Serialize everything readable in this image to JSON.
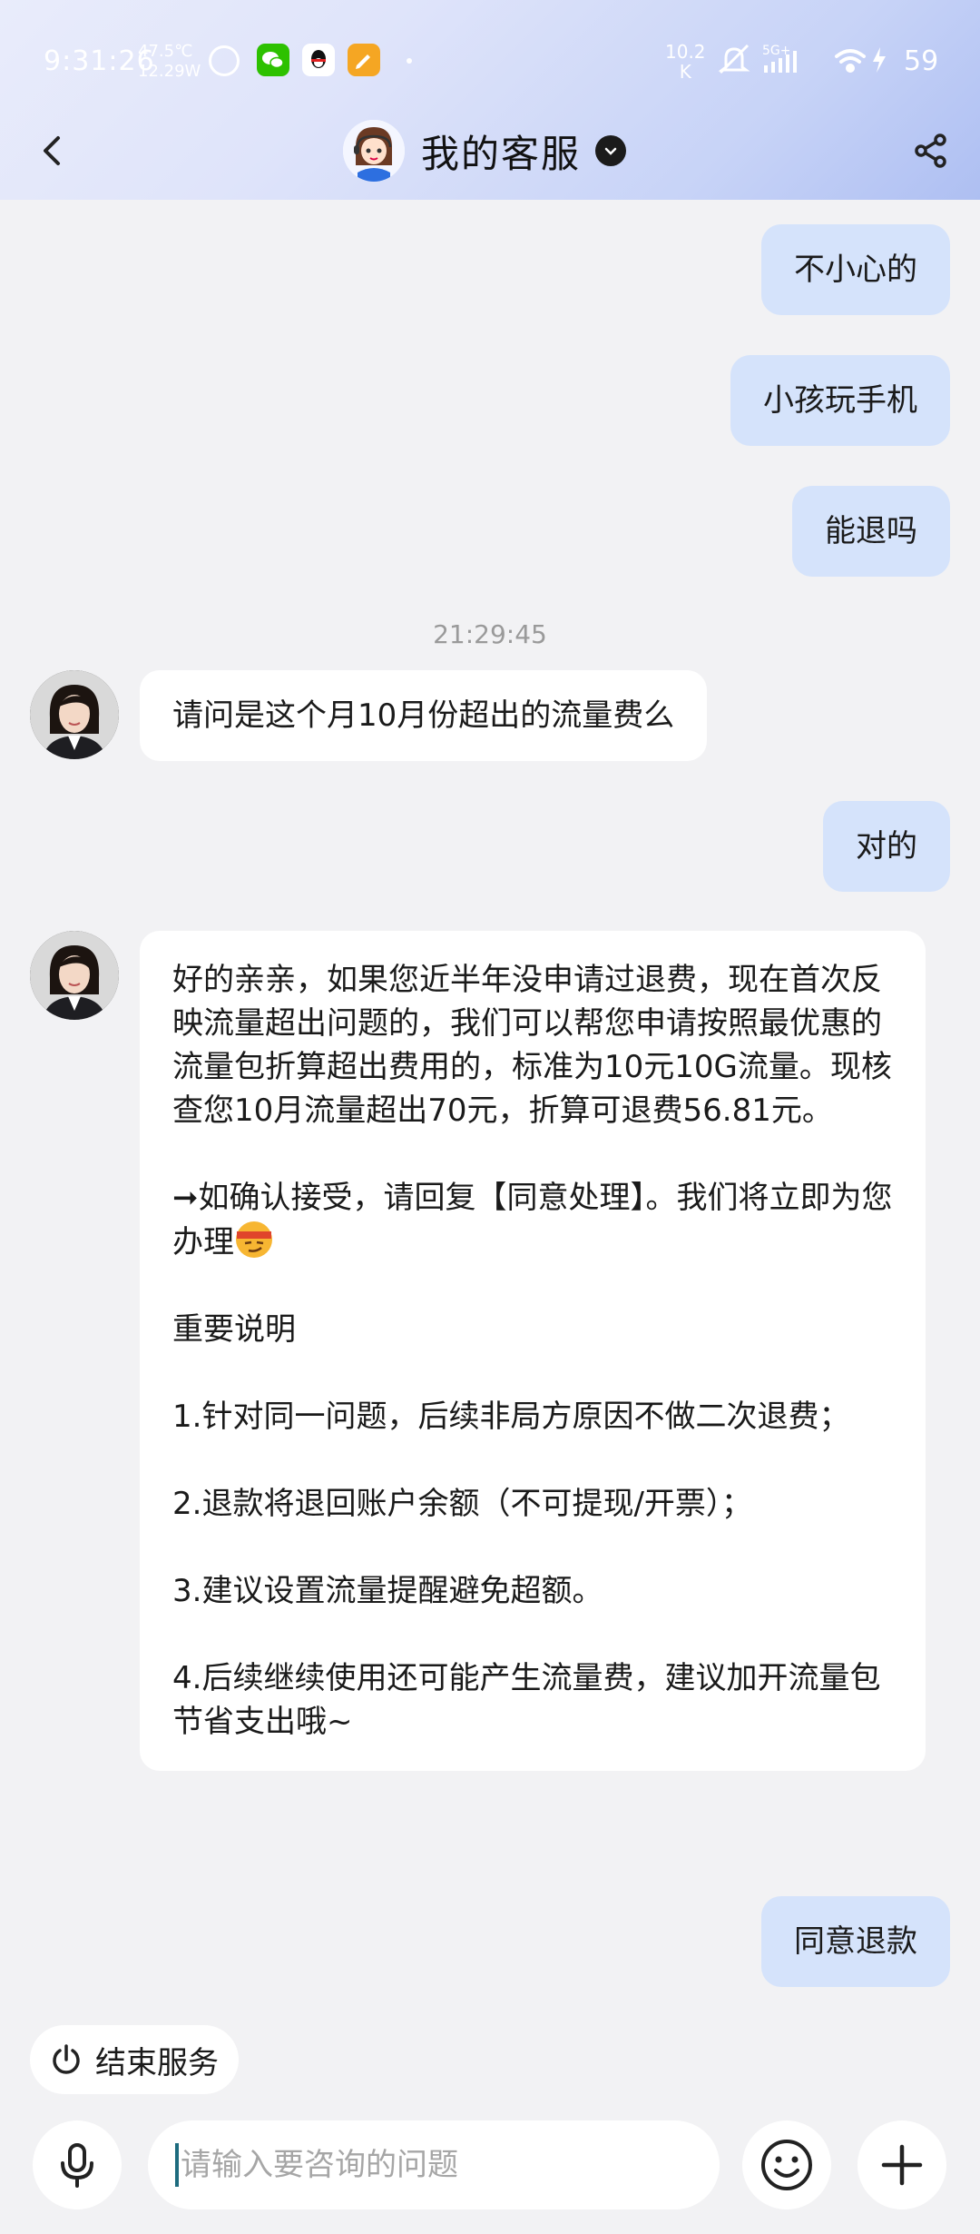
{
  "status_bar": {
    "time": "9:31:26",
    "temp": "47.5℃",
    "power": "12.29W",
    "net_speed_value": "10.2",
    "net_speed_unit": "K",
    "network": "5G+",
    "battery": "59"
  },
  "header": {
    "title": "我的客服"
  },
  "messages": {
    "m1": "不小心的",
    "m2": "小孩玩手机",
    "m3": "能退吗",
    "timestamp": "21:29:45",
    "m4": "请问是这个月10月份超出的流量费么",
    "m5": "对的",
    "m6": {
      "p1": "好的亲亲，如果您近半年没申请过退费，现在首次反映流量超出问题的，我们可以帮您申请按照最优惠的流量包折算超出费用的，标准为10元10G流量。现核查您10月流量超出70元，折算可退费56.81元。",
      "p2": "➞如确认接受，请回复【同意处理】。我们将立即为您办理",
      "p3": "重要说明",
      "p4": "1.针对同一问题，后续非局方原因不做二次退费；",
      "p5": "2.退款将退回账户余额（不可提现/开票）；",
      "p6": "3.建议设置流量提醒避免超额。",
      "p7": "4.后续继续使用还可能产生流量费，建议加开流量包节省支出哦~"
    },
    "m7": "同意退款"
  },
  "bottom": {
    "end_service": "结束服务",
    "input_placeholder": "请输入要咨询的问题"
  },
  "icons": {
    "back": "chevron-left-icon",
    "share": "share-icon",
    "verified": "chevron-down-badge-icon",
    "mic": "mic-icon",
    "emoji": "smiley-icon",
    "plus": "plus-icon",
    "power": "power-icon"
  },
  "colors": {
    "outgoing_bubble": "#d5e3fb",
    "incoming_bubble": "#ffffff",
    "background": "#f2f2f4",
    "header_gradient_end": "#aebff2"
  }
}
